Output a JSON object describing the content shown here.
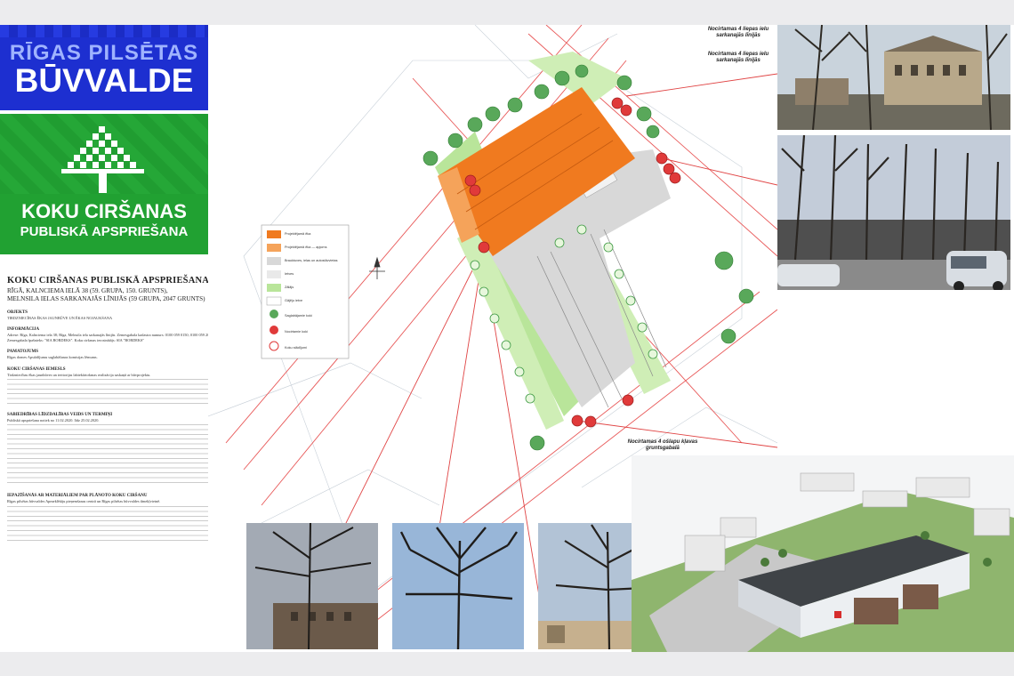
{
  "header_logo": {
    "line1": "RĪGAS PILSĒTAS",
    "line2": "BŪVVALDE"
  },
  "campaign_logo": {
    "line1": "KOKU CIRŠANAS",
    "line2": "PUBLISKĀ APSPRIEŠANA"
  },
  "document": {
    "title": "KOKU CIRŠANAS PUBLISKĀ APSPRIEŠANA",
    "address_line1": "RĪGĀ, KALNCIEMA IELĀ 38 (59. GRUPA, 150. GRUNTS),",
    "address_line2": "MELNSILA IELAS SARKANAJĀS LĪNIJĀS (59 GRUPA, 2047 GRUNTS)",
    "sections": [
      {
        "heading": "OBJEKTS",
        "text": "TIRDZNIECĪBAS ĒKAS JAUNBŪVE UN ĒKAS NOJAUKŠANA"
      },
      {
        "heading": "INFORMĀCIJA",
        "text": "Adrese: Rīga, Kalnciema iela 38; Rīga, Melnsila iela sarkanajās līnijās. Zemesgabala kadastra numurs: 0100 059 0150; 0100 059 2047. Zemesgabala īpašnieks: \"SIA BORDEKS\". Koku ciršanas ierosinātājs: SIA \"BORDEKS\""
      },
      {
        "heading": "PAMATOJUMS",
        "text": "Rīgas domes Apstādījumu saglabāšanas komisijas lēmums."
      },
      {
        "heading": "KOKU CIRŠANAS IEMESLS",
        "text": "Tirdzniecības ēkas jaunbūves un teritorijas labiekārtošanas realizācija saskaņā ar būvprojektu."
      },
      {
        "heading": "SABIEDRĪBAS LĪDZDALĪBAS VEIDS UN TERMIŅI",
        "text": "Publiskā apspriešana notiek no 11.02.2020. līdz 25.02.2020."
      },
      {
        "heading": "IEPAZĪŠANĀS AR MATERIĀLIEM PAR PLĀNOTO KOKU CIRŠANU",
        "text": "Rīgas pilsētas būvvaldes Apmeklētāju pieņemšanas centrā un Rīgas pilsētas būvvaldes tīmekļvietnē."
      }
    ]
  },
  "site_plan": {
    "legend_items": [
      "Projektējamā ēka",
      "Projektējamā ēka — apjoms",
      "Brauktuves, ielas un autostāvvietas",
      "Ietves",
      "Zālājs",
      "Gājēju ietve",
      "Saglabājamie koki",
      "Nocirtamie koki",
      "Koku stādījumi"
    ]
  },
  "callouts": [
    "Nocirtamas 4 liepas ielu sarkanajās līnijās",
    "Nocirtamas 4 liepas ielu sarkanajās līnijās",
    "Nocirtamas 4 ošlapu kļavas gruntsgabalā"
  ],
  "colors": {
    "building": "#f07a1f",
    "green_area": "#b9e59a",
    "cut_tree": "#e03a3a",
    "keep_tree": "#3f9a44",
    "redline": "#e63737",
    "blue_logo": "#1d2fd0",
    "green_logo": "#21a132"
  }
}
